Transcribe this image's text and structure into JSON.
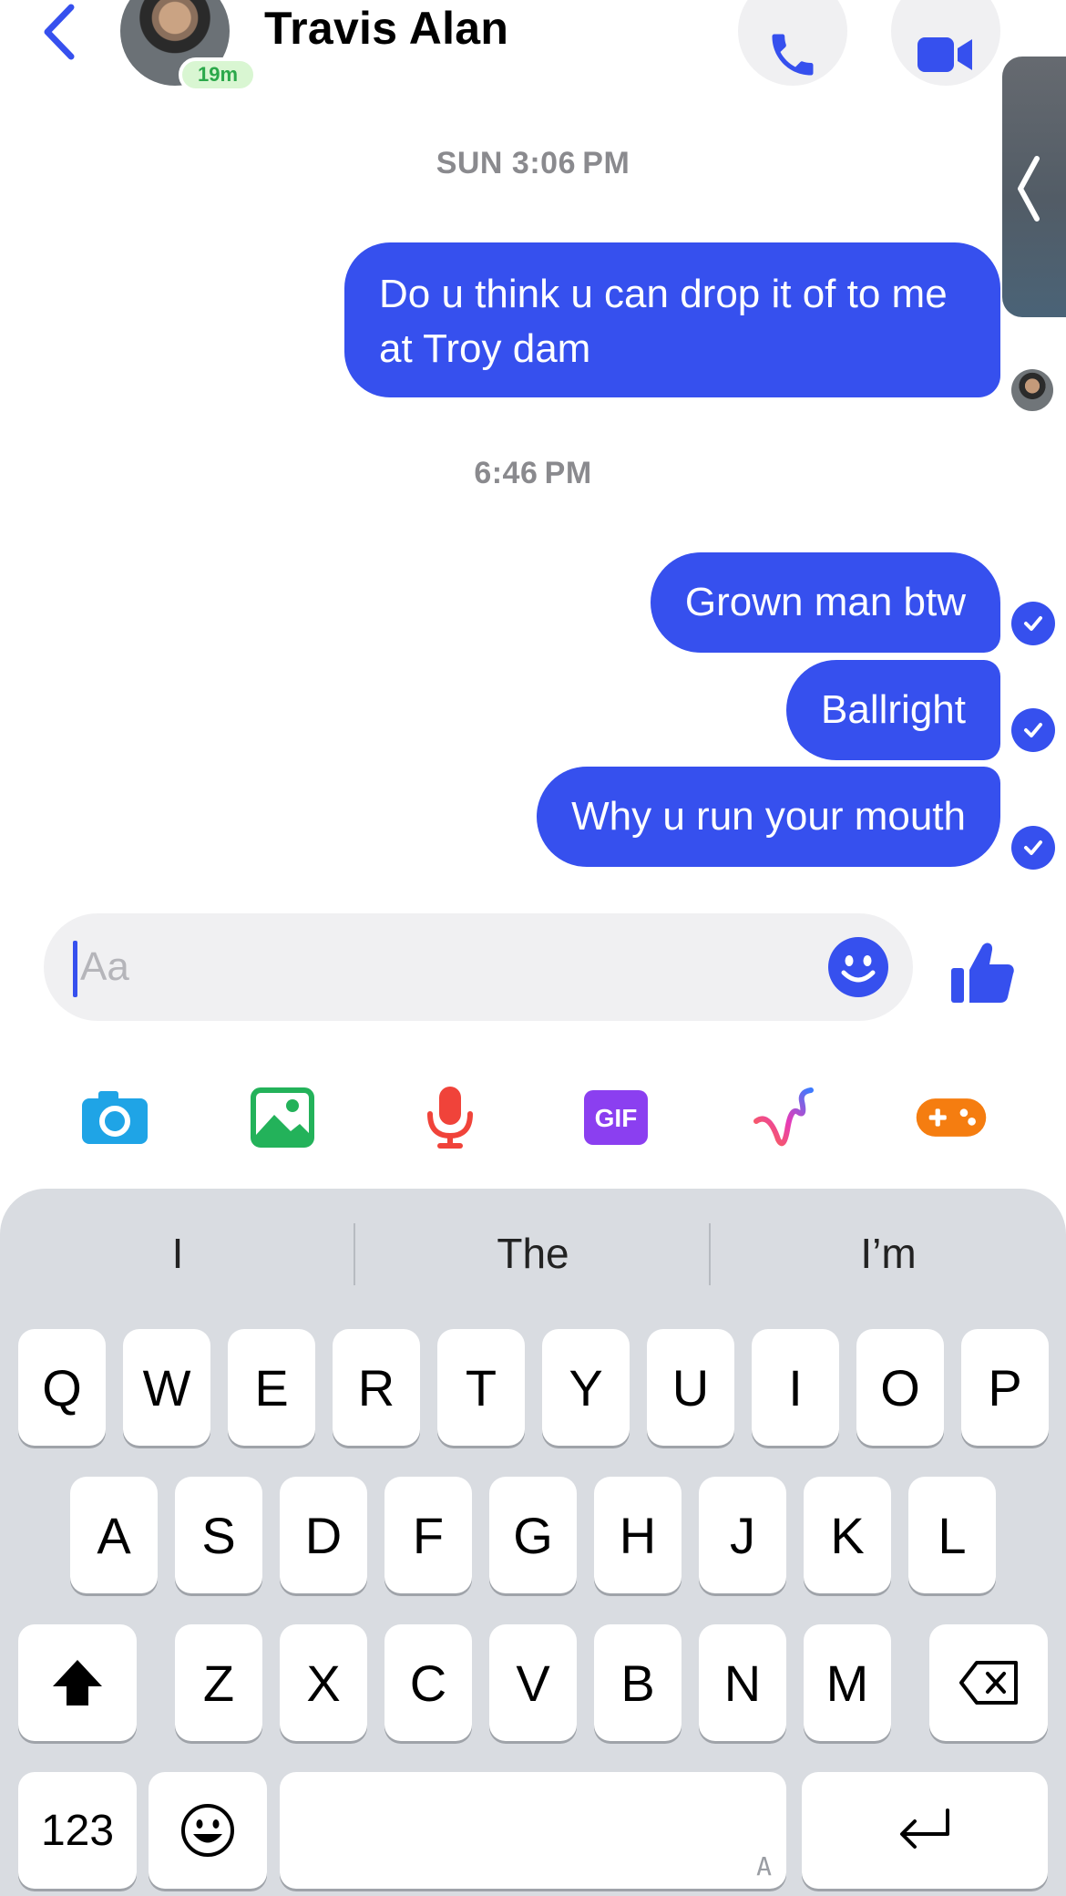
{
  "header": {
    "contact_name": "Travis Alan",
    "active_time": "19m"
  },
  "messages": [
    {
      "timestamp": "SUN 3:06 PM"
    },
    {
      "text": "Do u think u can drop it of to me at Troy dam"
    },
    {
      "timestamp": "6:46 PM"
    },
    {
      "text": "Grown man btw"
    },
    {
      "text": "Ballright"
    },
    {
      "text": "Why u run your mouth"
    }
  ],
  "composer": {
    "placeholder": "Aa"
  },
  "keyboard": {
    "suggestions": [
      "I",
      "The",
      "I’m"
    ],
    "row1": [
      "Q",
      "W",
      "E",
      "R",
      "T",
      "Y",
      "U",
      "I",
      "O",
      "P"
    ],
    "row2": [
      "A",
      "S",
      "D",
      "F",
      "G",
      "H",
      "J",
      "K",
      "L"
    ],
    "row3": [
      "Z",
      "X",
      "C",
      "V",
      "B",
      "N",
      "M"
    ],
    "numbers_key": "123",
    "space_hint": "A"
  },
  "colors": {
    "accent": "#3650ee",
    "keyboard_bg": "#d9dce1",
    "active_green": "#2ba84a"
  },
  "icons": [
    "back-chevron",
    "phone",
    "video-camera",
    "camera",
    "image",
    "microphone",
    "gif",
    "draw",
    "games",
    "emoji",
    "thumbs-up",
    "shift",
    "backspace",
    "return",
    "checkmark"
  ]
}
